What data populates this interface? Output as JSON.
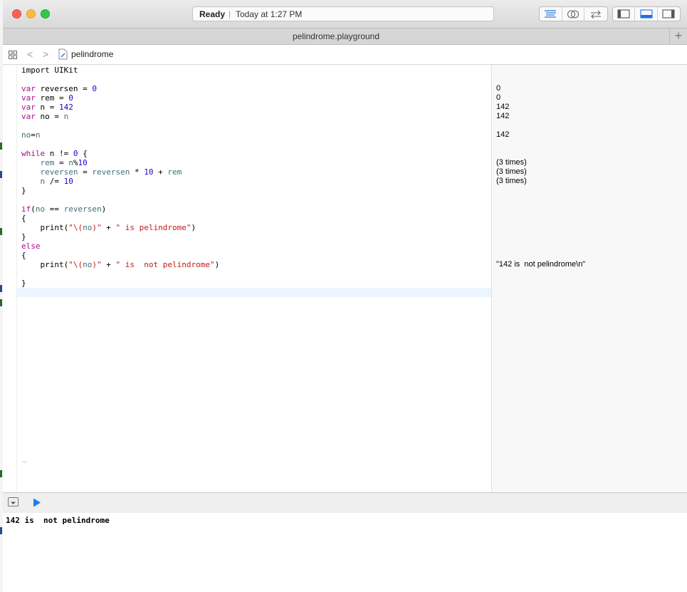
{
  "window": {
    "status": {
      "ready": "Ready",
      "separator": "|",
      "time": "Today at 1:27 PM"
    },
    "tab_title": "pelindrome.playground",
    "new_tab": "+"
  },
  "jumpbar": {
    "back": "<",
    "forward": ">",
    "file": "pelindrome"
  },
  "editor": {
    "lines": {
      "l0": "import UIKit",
      "l2_kw": "var",
      "l2_name": " reversen = ",
      "l2_val": "0",
      "l3_kw": "var",
      "l3_name": " rem = ",
      "l3_val": "0",
      "l4_kw": "var",
      "l4_name": " n = ",
      "l4_val": "142",
      "l5_kw": "var",
      "l5_name": " no = ",
      "l5_val": "n",
      "l7_a": "no",
      "l7_b": "=",
      "l7_c": "n",
      "l9_kw": "while",
      "l9_a": " n != ",
      "l9_num": "0",
      "l9_b": " {",
      "l10_a": "    ",
      "l10_v": "rem",
      "l10_b": " = ",
      "l10_v2": "n",
      "l10_c": "%",
      "l10_num": "10",
      "l11_a": "    ",
      "l11_v": "reversen",
      "l11_b": " = ",
      "l11_v2": "reversen",
      "l11_c": " * ",
      "l11_num": "10",
      "l11_d": " + ",
      "l11_v3": "rem",
      "l12_a": "    ",
      "l12_v": "n",
      "l12_b": " /= ",
      "l12_num": "10",
      "l13": "}",
      "l15_kw": "if",
      "l15_a": "(",
      "l15_v": "no",
      "l15_b": " == ",
      "l15_v2": "reversen",
      "l15_c": ")",
      "l16": "{",
      "l17_a": "    print(",
      "l17_s1": "\"\\(",
      "l17_v": "no",
      "l17_s2": ")\"",
      "l17_b": " + ",
      "l17_s3": "\" is pelindrome\"",
      "l17_c": ")",
      "l18": "}",
      "l19_kw": "else",
      "l20": "{",
      "l21_a": "    print(",
      "l21_s1": "\"\\(",
      "l21_v": "no",
      "l21_s2": ")\"",
      "l21_b": " + ",
      "l21_s3": "\" is  not pelindrome\"",
      "l21_c": ")",
      "l23": "}"
    },
    "cursor_mark": "_"
  },
  "results": {
    "r2": "0",
    "r3": "0",
    "r4": "142",
    "r5": "142",
    "r7": "142",
    "r10": "(3 times)",
    "r11": "(3 times)",
    "r12": "(3 times)",
    "r21": "\"142 is  not pelindrome\\n\""
  },
  "console": {
    "output": "142 is  not pelindrome"
  },
  "colors": {
    "keyword": "#aa0d91",
    "number": "#1c00cf",
    "variable": "#3f6e74",
    "string": "#c41a16",
    "play": "#1f7df2"
  }
}
